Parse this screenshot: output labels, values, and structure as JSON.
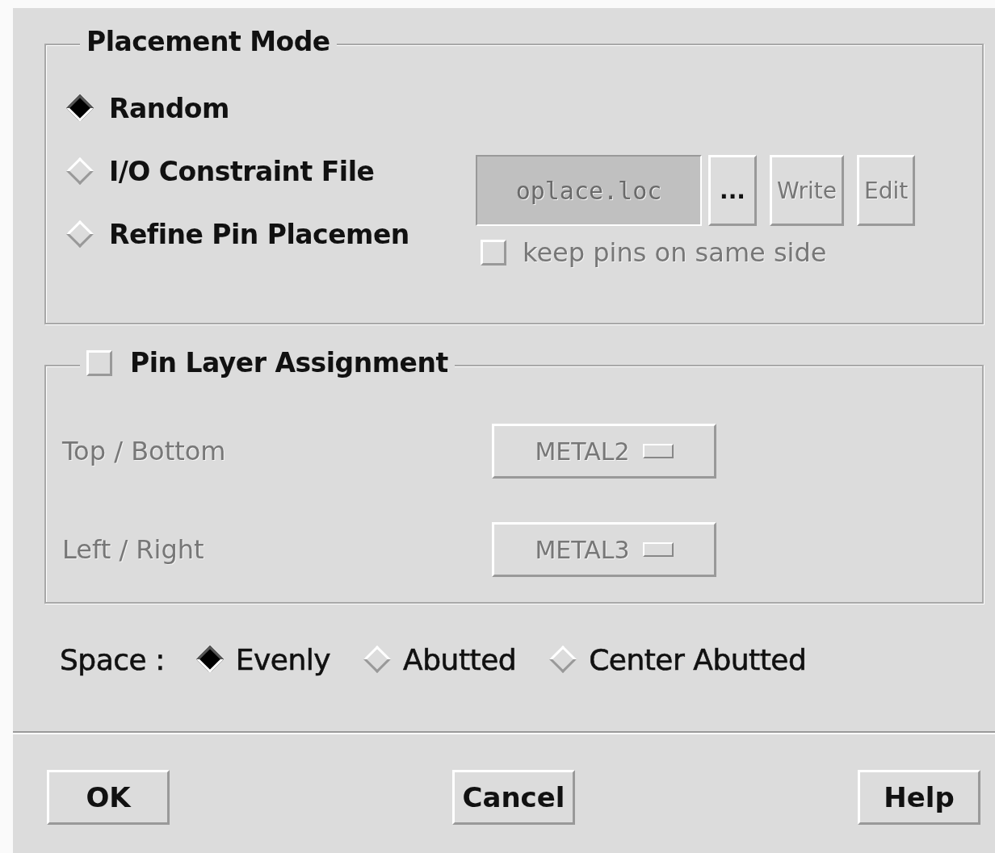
{
  "placement_mode": {
    "title": "Placement Mode",
    "options": [
      {
        "label": "Random",
        "selected": true
      },
      {
        "label": "I/O Constraint File",
        "selected": false
      },
      {
        "label": "Refine Pin Placemen",
        "selected": false
      }
    ],
    "file_field": {
      "value": "oplace.loc",
      "disabled": true
    },
    "file_buttons": [
      {
        "label": "...",
        "disabled": false
      },
      {
        "label": "Write",
        "disabled": true
      },
      {
        "label": "Edit",
        "disabled": true
      }
    ],
    "keep_pins": {
      "label": "keep pins on same side",
      "checked": false,
      "disabled": true
    }
  },
  "pin_layer_assignment": {
    "title": "Pin Layer Assignment",
    "checked": false,
    "rows": [
      {
        "label": "Top / Bottom",
        "value": "METAL2",
        "disabled": true
      },
      {
        "label": "Left / Right",
        "value": "METAL3",
        "disabled": true
      }
    ]
  },
  "space": {
    "label": "Space :",
    "options": [
      {
        "label": "Evenly",
        "selected": true
      },
      {
        "label": "Abutted",
        "selected": false
      },
      {
        "label": "Center Abutted",
        "selected": false
      }
    ]
  },
  "buttons": [
    "OK",
    "Cancel",
    "Help"
  ]
}
